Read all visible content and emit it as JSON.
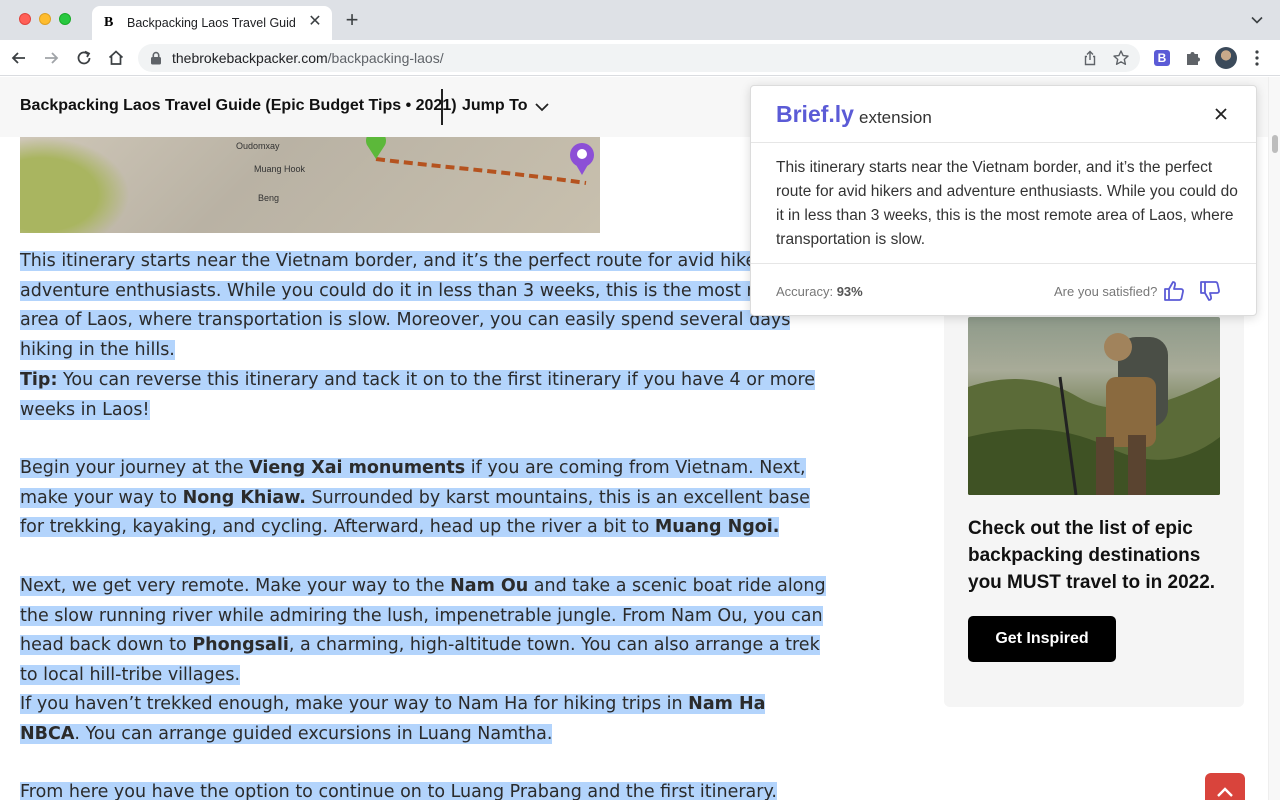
{
  "browser": {
    "tab_title": "Backpacking Laos Travel Guide",
    "tab_favicon": "B",
    "url_host": "thebrokebackpacker.com",
    "url_path": "/backpacking-laos/",
    "extension_badge": "B"
  },
  "header": {
    "title": "Backpacking Laos Travel Guide (Epic Budget Tips • 2021)",
    "jump_to": "Jump To"
  },
  "map": {
    "labels": [
      "Oudomxay",
      "Muang Hook",
      "Beng"
    ]
  },
  "article": {
    "p1": "This itinerary starts near the Vietnam border, and it’s the perfect route for avid hikers and adventure enthusiasts. While you could do it in less than 3 weeks, this is the most remote area of Laos, where transportation is slow. Moreover, you can easily spend several days hiking in the hills.",
    "p2_bold": "Tip:",
    "p2_text": " You can reverse this itinerary and tack it on to the first itinerary if you have 4 or more weeks in Laos!",
    "p3_a": "Begin your journey at the ",
    "p3_b1": "Vieng Xai monuments",
    "p3_c": " if you are coming from Vietnam. Next, make your way to ",
    "p3_b2": "Nong Khiaw.",
    "p3_d": " Surrounded by karst mountains,  this is an excellent base for trekking, kayaking, and cycling. Afterward, head up the river a bit to ",
    "p3_b3": "Muang Ngoi.",
    "p4_a": "Next, we get very remote. Make your way to the ",
    "p4_b1": "Nam Ou",
    "p4_c": " and take a scenic boat ride along the slow running river while admiring the lush, impenetrable jungle. From Nam Ou, you can head back down to ",
    "p4_b2": "Phongsali",
    "p4_d": ", a charming, high-altitude town. You can also arrange a trek to local hill-tribe villages.",
    "p5_a": "If you haven’t trekked enough, make your way to Nam Ha for hiking trips in ",
    "p5_b": "Nam Ha NBCA",
    "p5_c": ". You can arrange guided excursions in Luang Namtha.",
    "p6": "From here you have the option to continue on to Luang Prabang and the first itinerary."
  },
  "sidebar": {
    "heading": "Check out the list of epic backpacking destinations you MUST travel to in 2022.",
    "button": "Get Inspired"
  },
  "popup": {
    "brand": "Brief.ly",
    "brand_suffix": "extension",
    "summary": "This itinerary starts near the Vietnam border, and it’s the perfect route for avid hikers and adventure enthusiasts. While you could do it in less than 3 weeks, this is the most remote area of Laos, where transportation is slow.",
    "accuracy_label": "Accuracy:",
    "accuracy_value": "93%",
    "satisfied_label": "Are you satisfied?"
  },
  "colors": {
    "accent": "#5b5bd6",
    "highlight": "#b3d4fc",
    "scroll_top_button": "#d9443c"
  }
}
